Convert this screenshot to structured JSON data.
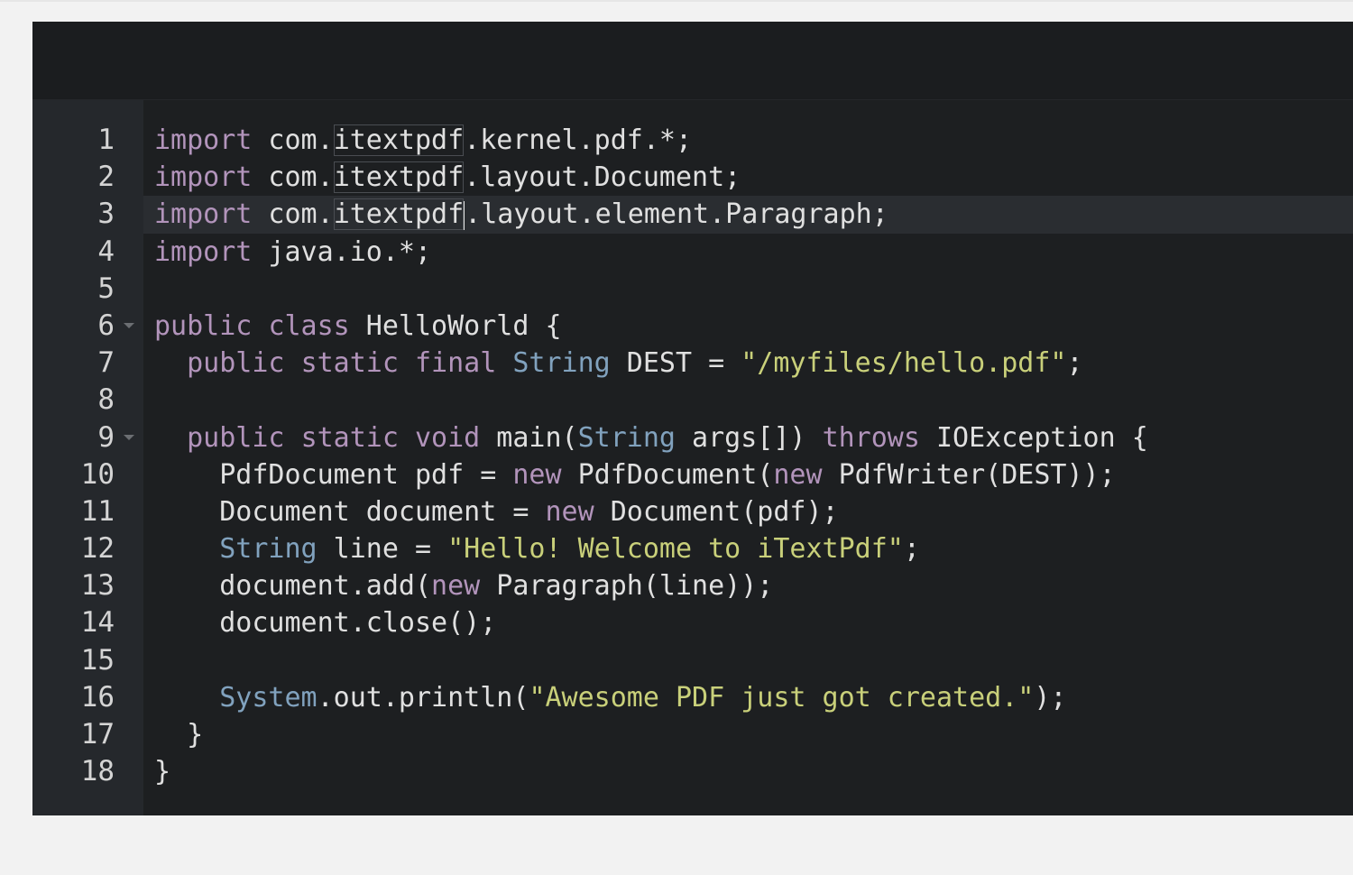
{
  "editor": {
    "language": "java",
    "active_line": 3,
    "colors": {
      "background": "#1d1f21",
      "gutter": "#25282c",
      "keyword": "#b294bb",
      "type": "#81a2be",
      "string": "#c9d07a",
      "text": "#e0e0e0"
    },
    "lines": [
      {
        "n": "1",
        "fold": false,
        "tokens": [
          {
            "t": "import",
            "c": "kw"
          },
          {
            "t": " com.",
            "c": "plain"
          },
          {
            "t": "itextpdf",
            "c": "plain",
            "hl": true
          },
          {
            "t": ".kernel.pdf.*;",
            "c": "plain"
          }
        ]
      },
      {
        "n": "2",
        "fold": false,
        "tokens": [
          {
            "t": "import",
            "c": "kw"
          },
          {
            "t": " com.",
            "c": "plain"
          },
          {
            "t": "itextpdf",
            "c": "plain",
            "hl": true
          },
          {
            "t": ".layout.Document;",
            "c": "plain"
          }
        ]
      },
      {
        "n": "3",
        "fold": false,
        "tokens": [
          {
            "t": "import",
            "c": "kw"
          },
          {
            "t": " com.",
            "c": "plain"
          },
          {
            "t": "itextpdf",
            "c": "plain",
            "hl": true,
            "cursor_after": true
          },
          {
            "t": ".layout.element.Paragraph;",
            "c": "plain"
          }
        ]
      },
      {
        "n": "4",
        "fold": false,
        "tokens": [
          {
            "t": "import",
            "c": "kw"
          },
          {
            "t": " java.io.*;",
            "c": "plain"
          }
        ]
      },
      {
        "n": "5",
        "fold": false,
        "tokens": []
      },
      {
        "n": "6",
        "fold": true,
        "tokens": [
          {
            "t": "public",
            "c": "kw"
          },
          {
            "t": " ",
            "c": "plain"
          },
          {
            "t": "class",
            "c": "kw"
          },
          {
            "t": " HelloWorld {",
            "c": "plain"
          }
        ]
      },
      {
        "n": "7",
        "fold": false,
        "tokens": [
          {
            "t": "  ",
            "c": "plain"
          },
          {
            "t": "public",
            "c": "kw"
          },
          {
            "t": " ",
            "c": "plain"
          },
          {
            "t": "static",
            "c": "kw"
          },
          {
            "t": " ",
            "c": "plain"
          },
          {
            "t": "final",
            "c": "kw"
          },
          {
            "t": " ",
            "c": "plain"
          },
          {
            "t": "String",
            "c": "type"
          },
          {
            "t": " DEST = ",
            "c": "plain"
          },
          {
            "t": "\"/myfiles/hello.pdf\"",
            "c": "str"
          },
          {
            "t": ";",
            "c": "plain"
          }
        ]
      },
      {
        "n": "8",
        "fold": false,
        "tokens": []
      },
      {
        "n": "9",
        "fold": true,
        "tokens": [
          {
            "t": "  ",
            "c": "plain"
          },
          {
            "t": "public",
            "c": "kw"
          },
          {
            "t": " ",
            "c": "plain"
          },
          {
            "t": "static",
            "c": "kw"
          },
          {
            "t": " ",
            "c": "plain"
          },
          {
            "t": "void",
            "c": "kw"
          },
          {
            "t": " main(",
            "c": "plain"
          },
          {
            "t": "String",
            "c": "type"
          },
          {
            "t": " args[]) ",
            "c": "plain"
          },
          {
            "t": "throws",
            "c": "kw"
          },
          {
            "t": " IOException {",
            "c": "plain"
          }
        ]
      },
      {
        "n": "10",
        "fold": false,
        "tokens": [
          {
            "t": "    PdfDocument pdf = ",
            "c": "plain"
          },
          {
            "t": "new",
            "c": "kw"
          },
          {
            "t": " PdfDocument(",
            "c": "plain"
          },
          {
            "t": "new",
            "c": "kw"
          },
          {
            "t": " PdfWriter(DEST));",
            "c": "plain"
          }
        ]
      },
      {
        "n": "11",
        "fold": false,
        "tokens": [
          {
            "t": "    Document document = ",
            "c": "plain"
          },
          {
            "t": "new",
            "c": "kw"
          },
          {
            "t": " Document(pdf);",
            "c": "plain"
          }
        ]
      },
      {
        "n": "12",
        "fold": false,
        "tokens": [
          {
            "t": "    ",
            "c": "plain"
          },
          {
            "t": "String",
            "c": "type"
          },
          {
            "t": " line = ",
            "c": "plain"
          },
          {
            "t": "\"Hello! Welcome to iTextPdf\"",
            "c": "str"
          },
          {
            "t": ";",
            "c": "plain"
          }
        ]
      },
      {
        "n": "13",
        "fold": false,
        "tokens": [
          {
            "t": "    document.add(",
            "c": "plain"
          },
          {
            "t": "new",
            "c": "kw"
          },
          {
            "t": " Paragraph(line));",
            "c": "plain"
          }
        ]
      },
      {
        "n": "14",
        "fold": false,
        "tokens": [
          {
            "t": "    document.close();",
            "c": "plain"
          }
        ]
      },
      {
        "n": "15",
        "fold": false,
        "tokens": []
      },
      {
        "n": "16",
        "fold": false,
        "tokens": [
          {
            "t": "    ",
            "c": "plain"
          },
          {
            "t": "System",
            "c": "type"
          },
          {
            "t": ".out.println(",
            "c": "plain"
          },
          {
            "t": "\"Awesome PDF just got created.\"",
            "c": "str"
          },
          {
            "t": ");",
            "c": "plain"
          }
        ]
      },
      {
        "n": "17",
        "fold": false,
        "tokens": [
          {
            "t": "  }",
            "c": "plain"
          }
        ]
      },
      {
        "n": "18",
        "fold": false,
        "tokens": [
          {
            "t": "}",
            "c": "plain"
          }
        ]
      }
    ]
  }
}
